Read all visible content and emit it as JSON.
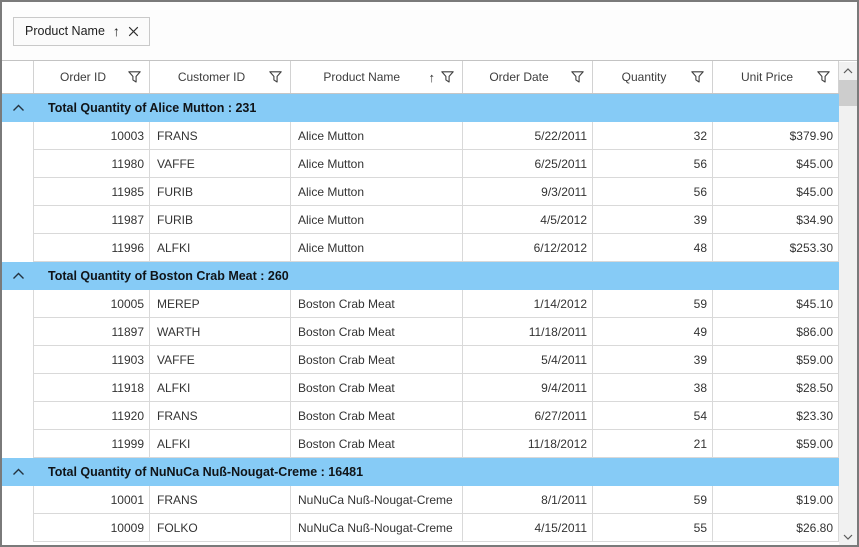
{
  "group_drop_area": {
    "chip": {
      "label": "Product Name",
      "sort_direction": "ascending"
    }
  },
  "columns": [
    {
      "key": "order_id",
      "label": "Order ID",
      "align": "right",
      "sorted": false,
      "has_filter": true
    },
    {
      "key": "customer_id",
      "label": "Customer ID",
      "align": "left",
      "sorted": false,
      "has_filter": true
    },
    {
      "key": "product_name",
      "label": "Product Name",
      "align": "left",
      "sorted": true,
      "has_filter": true
    },
    {
      "key": "order_date",
      "label": "Order Date",
      "align": "right",
      "sorted": false,
      "has_filter": true
    },
    {
      "key": "quantity",
      "label": "Quantity",
      "align": "right",
      "sorted": false,
      "has_filter": true
    },
    {
      "key": "unit_price",
      "label": "Unit Price",
      "align": "right",
      "sorted": false,
      "has_filter": true
    }
  ],
  "groups": [
    {
      "caption": "Total Quantity of Alice Mutton : 231",
      "expanded": true,
      "rows": [
        {
          "order_id": "10003",
          "customer_id": "FRANS",
          "product_name": "Alice Mutton",
          "order_date": "5/22/2011",
          "quantity": "32",
          "unit_price": "$379.90"
        },
        {
          "order_id": "11980",
          "customer_id": "VAFFE",
          "product_name": "Alice Mutton",
          "order_date": "6/25/2011",
          "quantity": "56",
          "unit_price": "$45.00"
        },
        {
          "order_id": "11985",
          "customer_id": "FURIB",
          "product_name": "Alice Mutton",
          "order_date": "9/3/2011",
          "quantity": "56",
          "unit_price": "$45.00"
        },
        {
          "order_id": "11987",
          "customer_id": "FURIB",
          "product_name": "Alice Mutton",
          "order_date": "4/5/2012",
          "quantity": "39",
          "unit_price": "$34.90"
        },
        {
          "order_id": "11996",
          "customer_id": "ALFKI",
          "product_name": "Alice Mutton",
          "order_date": "6/12/2012",
          "quantity": "48",
          "unit_price": "$253.30"
        }
      ]
    },
    {
      "caption": "Total Quantity of Boston Crab Meat : 260",
      "expanded": true,
      "rows": [
        {
          "order_id": "10005",
          "customer_id": "MEREP",
          "product_name": "Boston Crab Meat",
          "order_date": "1/14/2012",
          "quantity": "59",
          "unit_price": "$45.10"
        },
        {
          "order_id": "11897",
          "customer_id": "WARTH",
          "product_name": "Boston Crab Meat",
          "order_date": "11/18/2011",
          "quantity": "49",
          "unit_price": "$86.00"
        },
        {
          "order_id": "11903",
          "customer_id": "VAFFE",
          "product_name": "Boston Crab Meat",
          "order_date": "5/4/2011",
          "quantity": "39",
          "unit_price": "$59.00"
        },
        {
          "order_id": "11918",
          "customer_id": "ALFKI",
          "product_name": "Boston Crab Meat",
          "order_date": "9/4/2011",
          "quantity": "38",
          "unit_price": "$28.50"
        },
        {
          "order_id": "11920",
          "customer_id": "FRANS",
          "product_name": "Boston Crab Meat",
          "order_date": "6/27/2011",
          "quantity": "54",
          "unit_price": "$23.30"
        },
        {
          "order_id": "11999",
          "customer_id": "ALFKI",
          "product_name": "Boston Crab Meat",
          "order_date": "11/18/2012",
          "quantity": "21",
          "unit_price": "$59.00"
        }
      ]
    },
    {
      "caption": "Total Quantity of NuNuCa Nuß-Nougat-Creme : 16481",
      "expanded": true,
      "rows": [
        {
          "order_id": "10001",
          "customer_id": "FRANS",
          "product_name": "NuNuCa Nuß-Nougat-Creme",
          "order_date": "8/1/2011",
          "quantity": "59",
          "unit_price": "$19.00"
        },
        {
          "order_id": "10009",
          "customer_id": "FOLKO",
          "product_name": "NuNuCa Nuß-Nougat-Creme",
          "order_date": "4/15/2011",
          "quantity": "55",
          "unit_price": "$26.80"
        }
      ]
    }
  ],
  "colors": {
    "group_caption_bg": "#86cbf6",
    "grid_line": "#d9d9d9",
    "window_border": "#7a7a7a",
    "scrollbar_track": "#f1f1f1",
    "scrollbar_thumb": "#cdcdcd"
  }
}
